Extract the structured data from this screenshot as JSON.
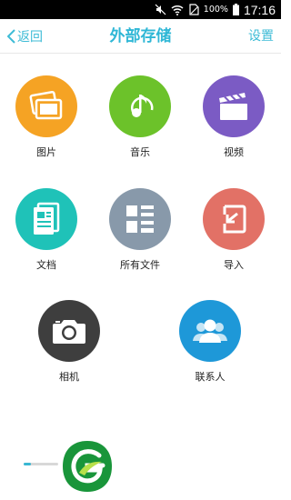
{
  "status_bar": {
    "battery_percent": "100%",
    "time": "17:16",
    "icons": [
      "mute-icon",
      "wifi-icon",
      "sim-off-icon",
      "battery-icon"
    ]
  },
  "header": {
    "back_label": "返回",
    "title": "外部存储",
    "settings_label": "设置"
  },
  "grid": {
    "items": [
      {
        "label": "图片",
        "icon": "pictures-icon",
        "color": "#f5a324"
      },
      {
        "label": "音乐",
        "icon": "music-icon",
        "color": "#6cc22a"
      },
      {
        "label": "视频",
        "icon": "video-icon",
        "color": "#7b5bc4"
      },
      {
        "label": "文档",
        "icon": "document-icon",
        "color": "#1fc2b8"
      },
      {
        "label": "所有文件",
        "icon": "all-files-icon",
        "color": "#8899aa"
      },
      {
        "label": "导入",
        "icon": "import-icon",
        "color": "#e27166"
      },
      {
        "label": "相机",
        "icon": "camera-icon",
        "color": "#3e3e3e"
      },
      {
        "label": "联系人",
        "icon": "contacts-icon",
        "color": "#1e98d8"
      }
    ]
  },
  "footer": {
    "progress_fraction": 0.2,
    "logo_icon": "app-logo-icon",
    "accent_color": "#39b7d3"
  }
}
